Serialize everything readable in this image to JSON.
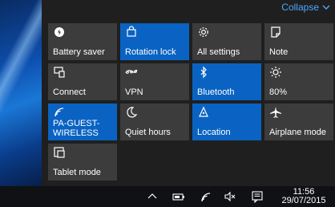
{
  "action_center": {
    "collapse_label": "Collapse",
    "tiles": [
      {
        "label": "Battery saver",
        "icon": "battery-saver-icon",
        "active": false
      },
      {
        "label": "Rotation lock",
        "icon": "rotation-lock-icon",
        "active": true
      },
      {
        "label": "All settings",
        "icon": "gear-icon",
        "active": false
      },
      {
        "label": "Note",
        "icon": "note-icon",
        "active": false
      },
      {
        "label": "Connect",
        "icon": "connect-icon",
        "active": false
      },
      {
        "label": "VPN",
        "icon": "vpn-icon",
        "active": false
      },
      {
        "label": "Bluetooth",
        "icon": "bluetooth-icon",
        "active": true
      },
      {
        "label": "80%",
        "icon": "brightness-icon",
        "active": false
      },
      {
        "label": "PA-GUEST-\nWIRELESS",
        "icon": "wifi-icon",
        "active": true
      },
      {
        "label": "Quiet hours",
        "icon": "moon-icon",
        "active": false
      },
      {
        "label": "Location",
        "icon": "location-icon",
        "active": true
      },
      {
        "label": "Airplane mode",
        "icon": "airplane-icon",
        "active": false
      },
      {
        "label": "Tablet mode",
        "icon": "tablet-mode-icon",
        "active": false
      }
    ]
  },
  "taskbar": {
    "time": "11:56",
    "date": "29/07/2015",
    "tray_icons": [
      "chevron-up-icon",
      "battery-icon",
      "wifi-icon",
      "speaker-muted-icon",
      "action-center-icon"
    ]
  },
  "colors": {
    "accent": "#0a63c2",
    "tile_inactive": "#3c3c3c",
    "panel_bg": "#1f1f1f",
    "link": "#4da6ff",
    "taskbar_bg": "#0f1114"
  }
}
